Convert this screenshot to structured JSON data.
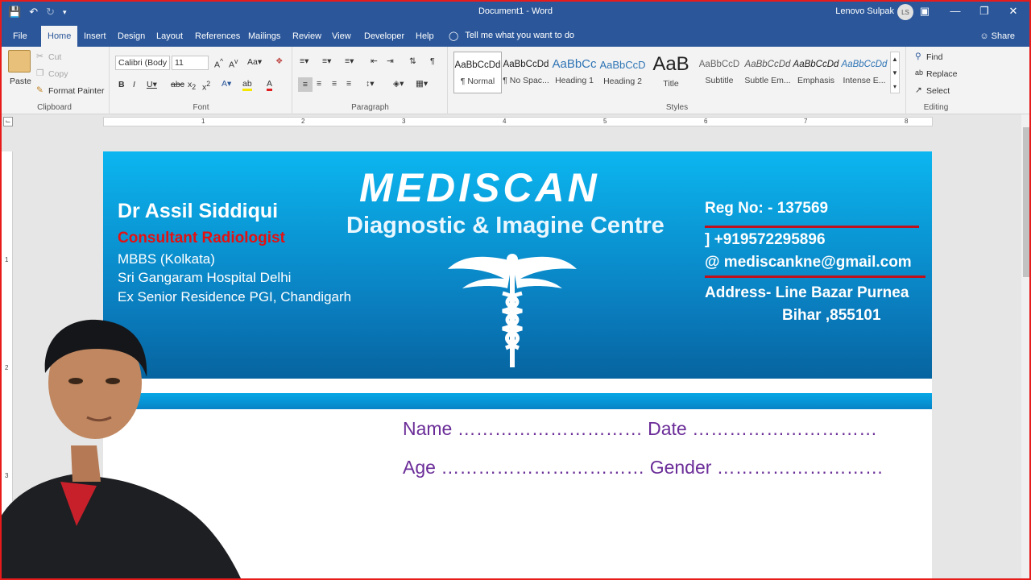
{
  "window": {
    "title": "Document1  -  Word",
    "user": "Lenovo Sulpak",
    "avatar_initials": "LS"
  },
  "tabs": [
    "File",
    "Home",
    "Insert",
    "Design",
    "Layout",
    "References",
    "Mailings",
    "Review",
    "View",
    "Developer",
    "Help"
  ],
  "tell_me": "Tell me what you want to do",
  "share": "Share",
  "clipboard": {
    "paste": "Paste",
    "cut": "Cut",
    "copy": "Copy",
    "format_painter": "Format Painter",
    "label": "Clipboard"
  },
  "font": {
    "family": "Calibri (Body",
    "size": "11",
    "label": "Font"
  },
  "paragraph": {
    "label": "Paragraph"
  },
  "styles": {
    "label": "Styles",
    "items": [
      {
        "sample": "AaBbCcDd",
        "name": "¶ Normal"
      },
      {
        "sample": "AaBbCcDd",
        "name": "¶ No Spac..."
      },
      {
        "sample": "AaBbCc",
        "name": "Heading 1"
      },
      {
        "sample": "AaBbCcD",
        "name": "Heading 2"
      },
      {
        "sample": "AaB",
        "name": "Title"
      },
      {
        "sample": "AaBbCcD",
        "name": "Subtitle"
      },
      {
        "sample": "AaBbCcDd",
        "name": "Subtle Em..."
      },
      {
        "sample": "AaBbCcDd",
        "name": "Emphasis"
      },
      {
        "sample": "AaBbCcDd",
        "name": "Intense E..."
      }
    ]
  },
  "editing": {
    "find": "Find",
    "replace": "Replace",
    "select": "Select",
    "label": "Editing"
  },
  "ruler": {
    "numbers": [
      "1",
      "2",
      "3",
      "4",
      "5",
      "6",
      "7",
      "8"
    ],
    "vertical_numbers": [
      "1",
      "2",
      "3"
    ]
  },
  "card": {
    "logo": "MEDISCAN",
    "subtitle": "Diagnostic & Imagine Centre",
    "doctor_name": "Dr Assil Siddiqui",
    "role": "Consultant Radiologist",
    "qualifications": [
      "MBBS (Kolkata)",
      "Sri Gangaram Hospital Delhi",
      "Ex Senior Residence PGI, Chandigarh"
    ],
    "reg": "Reg No: - 137569",
    "phone": "] +919572295896",
    "email": "@ mediscankne@gmail.com",
    "address_line1": "Address- Line Bazar Purnea",
    "address_line2": "Bihar ,855101",
    "field_name": "Name ………………………… Date …………………………",
    "field_age": "Age …………………………… Gender ………………………"
  },
  "colors": {
    "word_blue": "#2b579a",
    "banner_top": "#0bb6f0",
    "banner_bottom": "#06649f",
    "role_red": "#e51010",
    "field_purple": "#6b2d98"
  }
}
